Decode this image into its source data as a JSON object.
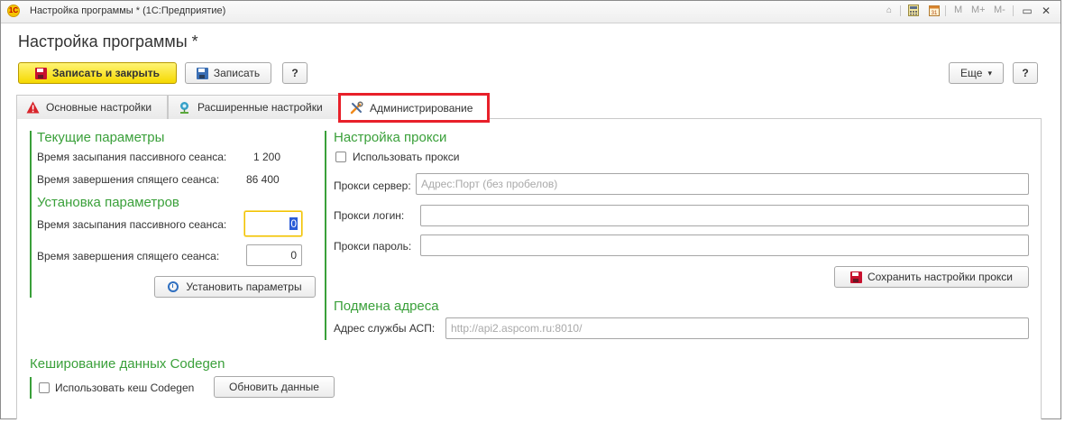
{
  "window": {
    "title": "Настройка программы * (1С:Предприятие)",
    "logo": "1С",
    "toolbar": {
      "m": "M",
      "m_plus": "M+",
      "m_minus": "M-"
    },
    "buttons": {
      "minimize": "▭",
      "close": "✕"
    }
  },
  "page_title": "Настройка программы *",
  "command_bar": {
    "save_close": "Записать и закрыть",
    "save": "Записать",
    "help": "?",
    "more": "Еще",
    "more_arrow": "▾",
    "help_right": "?"
  },
  "tabs": [
    {
      "label": "Основные настройки",
      "icon": "warning-icon"
    },
    {
      "label": "Расширенные настройки",
      "icon": "network-icon"
    },
    {
      "label": "Администрирование",
      "icon": "tools-icon",
      "active": true
    }
  ],
  "current_params": {
    "title": "Текущие параметры",
    "sleep_label": "Время засыпания пассивного сеанса:",
    "sleep_value": "1 200",
    "end_label": "Время завершения спящего сеанса:",
    "end_value": "86 400"
  },
  "set_params": {
    "title": "Установка параметров",
    "sleep_label": "Время засыпания пассивного сеанса:",
    "sleep_value": "0",
    "end_label": "Время завершения спящего сеанса:",
    "end_value": "0",
    "apply_button": "Установить параметры"
  },
  "proxy": {
    "title": "Настройка прокси",
    "use_proxy": "Использовать прокси",
    "use_proxy_checked": false,
    "server_label": "Прокси сервер:",
    "server_placeholder": "Адрес:Порт (без пробелов)",
    "server_value": "",
    "login_label": "Прокси логин:",
    "login_value": "",
    "password_label": "Прокси пароль:",
    "password_value": "",
    "save_button": "Сохранить настройки прокси"
  },
  "address": {
    "title": "Подмена адреса",
    "asp_label": "Адрес службы АСП:",
    "asp_placeholder": "http://api2.aspcom.ru:8010/",
    "asp_value": ""
  },
  "codegen": {
    "title": "Кеширование данных Codegen",
    "use_cache": "Использовать кеш Codegen",
    "use_cache_checked": false,
    "refresh_button": "Обновить данные"
  },
  "colors": {
    "accent_green": "#3aa03a",
    "primary_yellow": "#f5d800",
    "highlight_red": "#e8202a",
    "focus_yellow": "#f2c200"
  }
}
